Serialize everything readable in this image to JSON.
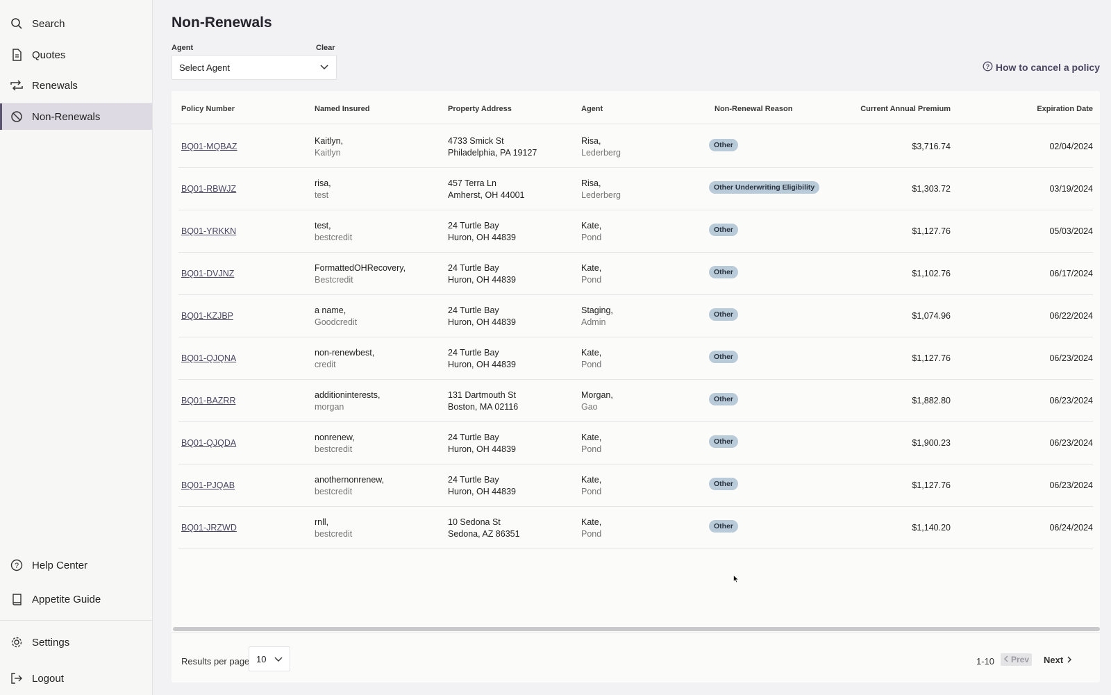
{
  "sidebar": {
    "top_items": [
      {
        "label": "Search",
        "icon": "search-icon"
      },
      {
        "label": "Quotes",
        "icon": "document-icon"
      },
      {
        "label": "Renewals",
        "icon": "renew-arrows-icon"
      },
      {
        "label": "Non-Renewals",
        "icon": "prohibited-icon",
        "active": true
      }
    ],
    "bottom_items": [
      {
        "label": "Help Center",
        "icon": "help-circle-icon"
      },
      {
        "label": "Appetite Guide",
        "icon": "book-icon"
      },
      {
        "label": "Settings",
        "icon": "gear-icon"
      },
      {
        "label": "Logout",
        "icon": "logout-icon"
      }
    ]
  },
  "page": {
    "title": "Non-Renewals",
    "agent_label": "Agent",
    "clear_label": "Clear",
    "agent_select_value": "Select Agent",
    "help_link": "How to cancel a policy"
  },
  "table": {
    "headers": [
      "Policy Number",
      "Named Insured",
      "Property Address",
      "Agent",
      "Non-Renewal Reason",
      "Current Annual Premium",
      "Expiration Date"
    ],
    "rows": [
      {
        "policy": "BQ01-MQBAZ",
        "insured1": "Kaitlyn,",
        "insured2": "Kaitlyn",
        "addr1": "4733 Smick St",
        "addr2": "Philadelphia, PA 19127",
        "agent1": "Risa,",
        "agent2": "Lederberg",
        "reason": "Other",
        "premium": "$3,716.74",
        "expiration": "02/04/2024"
      },
      {
        "policy": "BQ01-RBWJZ",
        "insured1": "risa,",
        "insured2": "test",
        "addr1": "457 Terra Ln",
        "addr2": "Amherst, OH 44001",
        "agent1": "Risa,",
        "agent2": "Lederberg",
        "reason": "Other Underwriting Eligibility",
        "premium": "$1,303.72",
        "expiration": "03/19/2024"
      },
      {
        "policy": "BQ01-YRKKN",
        "insured1": "test,",
        "insured2": "bestcredit",
        "addr1": "24 Turtle Bay",
        "addr2": "Huron, OH 44839",
        "agent1": "Kate,",
        "agent2": "Pond",
        "reason": "Other",
        "premium": "$1,127.76",
        "expiration": "05/03/2024"
      },
      {
        "policy": "BQ01-DVJNZ",
        "insured1": "FormattedOHRecovery,",
        "insured2": "Bestcredit",
        "addr1": "24 Turtle Bay",
        "addr2": "Huron, OH 44839",
        "agent1": "Kate,",
        "agent2": "Pond",
        "reason": "Other",
        "premium": "$1,102.76",
        "expiration": "06/17/2024"
      },
      {
        "policy": "BQ01-KZJBP",
        "insured1": "a name,",
        "insured2": "Goodcredit",
        "addr1": "24 Turtle Bay",
        "addr2": "Huron, OH 44839",
        "agent1": "Staging,",
        "agent2": "Admin",
        "reason": "Other",
        "premium": "$1,074.96",
        "expiration": "06/22/2024"
      },
      {
        "policy": "BQ01-QJQNA",
        "insured1": "non-renewbest,",
        "insured2": "credit",
        "addr1": "24 Turtle Bay",
        "addr2": "Huron, OH 44839",
        "agent1": "Kate,",
        "agent2": "Pond",
        "reason": "Other",
        "premium": "$1,127.76",
        "expiration": "06/23/2024"
      },
      {
        "policy": "BQ01-BAZRR",
        "insured1": "additioninterests,",
        "insured2": "morgan",
        "addr1": "131 Dartmouth St",
        "addr2": "Boston, MA 02116",
        "agent1": "Morgan,",
        "agent2": "Gao",
        "reason": "Other",
        "premium": "$1,882.80",
        "expiration": "06/23/2024"
      },
      {
        "policy": "BQ01-QJQDA",
        "insured1": "nonrenew,",
        "insured2": "bestcredit",
        "addr1": "24 Turtle Bay",
        "addr2": "Huron, OH 44839",
        "agent1": "Kate,",
        "agent2": "Pond",
        "reason": "Other",
        "premium": "$1,900.23",
        "expiration": "06/23/2024"
      },
      {
        "policy": "BQ01-PJQAB",
        "insured1": "anothernonrenew,",
        "insured2": "bestcredit",
        "addr1": "24 Turtle Bay",
        "addr2": "Huron, OH 44839",
        "agent1": "Kate,",
        "agent2": "Pond",
        "reason": "Other",
        "premium": "$1,127.76",
        "expiration": "06/23/2024"
      },
      {
        "policy": "BQ01-JRZWD",
        "insured1": "rnll,",
        "insured2": "bestcredit",
        "addr1": "10 Sedona St",
        "addr2": "Sedona, AZ 86351",
        "agent1": "Kate,",
        "agent2": "Pond",
        "reason": "Other",
        "premium": "$1,140.20",
        "expiration": "06/24/2024"
      }
    ]
  },
  "pagination": {
    "results_label": "Results per page",
    "per_page_value": "10",
    "range": "1-10",
    "prev_label": "Prev",
    "next_label": "Next"
  },
  "colors": {
    "accent": "#4a4560",
    "active_nav_bg": "#dddae3",
    "badge_bg": "#b9cad8"
  }
}
